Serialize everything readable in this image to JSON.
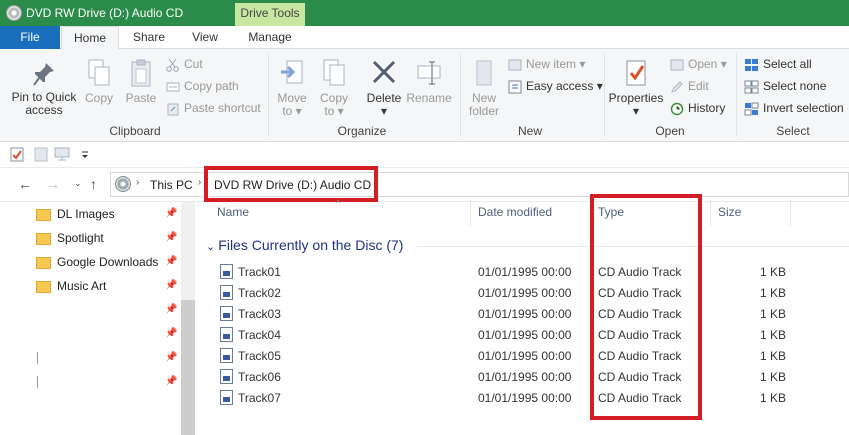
{
  "window": {
    "title": "DVD RW Drive (D:) Audio CD",
    "contextual_tab": "Drive Tools"
  },
  "tabs": {
    "file": "File",
    "home": "Home",
    "share": "Share",
    "view": "View",
    "manage": "Manage"
  },
  "ribbon": {
    "clipboard": {
      "label": "Clipboard",
      "pin_line1": "Pin to Quick",
      "pin_line2": "access",
      "copy": "Copy",
      "paste": "Paste",
      "cut": "Cut",
      "copy_path": "Copy path",
      "paste_shortcut": "Paste shortcut"
    },
    "organize": {
      "label": "Organize",
      "move_line1": "Move",
      "move_line2": "to",
      "copy_line1": "Copy",
      "copy_line2": "to",
      "delete": "Delete",
      "rename": "Rename"
    },
    "new": {
      "label": "New",
      "new_folder_line1": "New",
      "new_folder_line2": "folder",
      "new_item": "New item",
      "easy_access": "Easy access"
    },
    "open": {
      "label": "Open",
      "properties": "Properties",
      "open": "Open",
      "edit": "Edit",
      "history": "History"
    },
    "select": {
      "label": "Select",
      "select_all": "Select all",
      "select_none": "Select none",
      "invert_selection": "Invert selection"
    }
  },
  "address": {
    "this_pc": "This PC",
    "current": "DVD RW Drive (D:) Audio CD"
  },
  "nav_pane": {
    "items": [
      {
        "label": "DL Images"
      },
      {
        "label": "Spotlight"
      },
      {
        "label": "Google Downloads"
      },
      {
        "label": "Music Art"
      }
    ]
  },
  "columns": {
    "name": "Name",
    "date_modified": "Date modified",
    "type": "Type",
    "size": "Size"
  },
  "group": {
    "header": "Files Currently on the Disc (7)"
  },
  "files": [
    {
      "name": "Track01",
      "date": "01/01/1995 00:00",
      "type": "CD Audio Track",
      "size": "1 KB"
    },
    {
      "name": "Track02",
      "date": "01/01/1995 00:00",
      "type": "CD Audio Track",
      "size": "1 KB"
    },
    {
      "name": "Track03",
      "date": "01/01/1995 00:00",
      "type": "CD Audio Track",
      "size": "1 KB"
    },
    {
      "name": "Track04",
      "date": "01/01/1995 00:00",
      "type": "CD Audio Track",
      "size": "1 KB"
    },
    {
      "name": "Track05",
      "date": "01/01/1995 00:00",
      "type": "CD Audio Track",
      "size": "1 KB"
    },
    {
      "name": "Track06",
      "date": "01/01/1995 00:00",
      "type": "CD Audio Track",
      "size": "1 KB"
    },
    {
      "name": "Track07",
      "date": "01/01/1995 00:00",
      "type": "CD Audio Track",
      "size": "1 KB"
    }
  ],
  "colors": {
    "titlebar": "#2b8c4a",
    "file_tab": "#1a6fbd",
    "contextual_tab": "#c7e6a0",
    "highlight_box": "#d41e27",
    "group_header": "#1e3287"
  }
}
